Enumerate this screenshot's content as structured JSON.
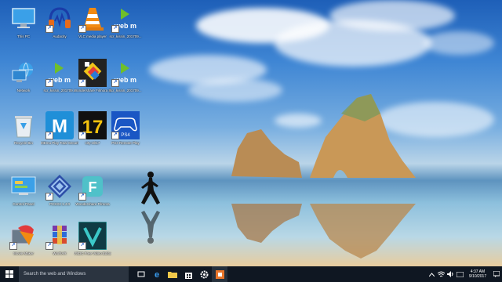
{
  "desktop": {
    "icons": [
      {
        "label": "This PC",
        "icon": "monitor-icon"
      },
      {
        "label": "Audacity",
        "icon": "headphones-icon"
      },
      {
        "label": "VLC media player",
        "icon": "traffic-cone-icon"
      },
      {
        "label": "scr_kissin_201709...",
        "icon": "webm-file-icon"
      },
      {
        "label": "Network",
        "icon": "network-icon"
      },
      {
        "label": "scr_kissin_201709...",
        "icon": "webm-file-icon"
      },
      {
        "label": "Wondershare Filmora Scrn",
        "icon": "filmora-scrn-icon"
      },
      {
        "label": "scr_kissin_201709...",
        "icon": "webm-file-icon"
      },
      {
        "label": "Recycle Bin",
        "icon": "recycle-bin-icon"
      },
      {
        "label": "MEmu Play Total Security 360",
        "icon": "m-app-icon"
      },
      {
        "label": "city-Ult17",
        "icon": "number-17-icon"
      },
      {
        "label": "PS4 Remote Play",
        "icon": "ps4-gamepad-icon"
      },
      {
        "label": "Control Panel",
        "icon": "control-panel-icon"
      },
      {
        "label": "PCSX2 1.4.0",
        "icon": "pcsx2-icon"
      },
      {
        "label": "Wondershare Filmora",
        "icon": "filmora-icon"
      },
      {
        "label": "Movie Maker",
        "icon": "movie-maker-icon"
      },
      {
        "label": "WinRAR",
        "icon": "winrar-icon"
      },
      {
        "label": "VSDC Free Video Editor",
        "icon": "vsdc-icon"
      }
    ]
  },
  "taskbar": {
    "search_placeholder": "Search the web and Windows",
    "clock_time": "4:37 AM",
    "clock_date": "9/10/2017"
  }
}
